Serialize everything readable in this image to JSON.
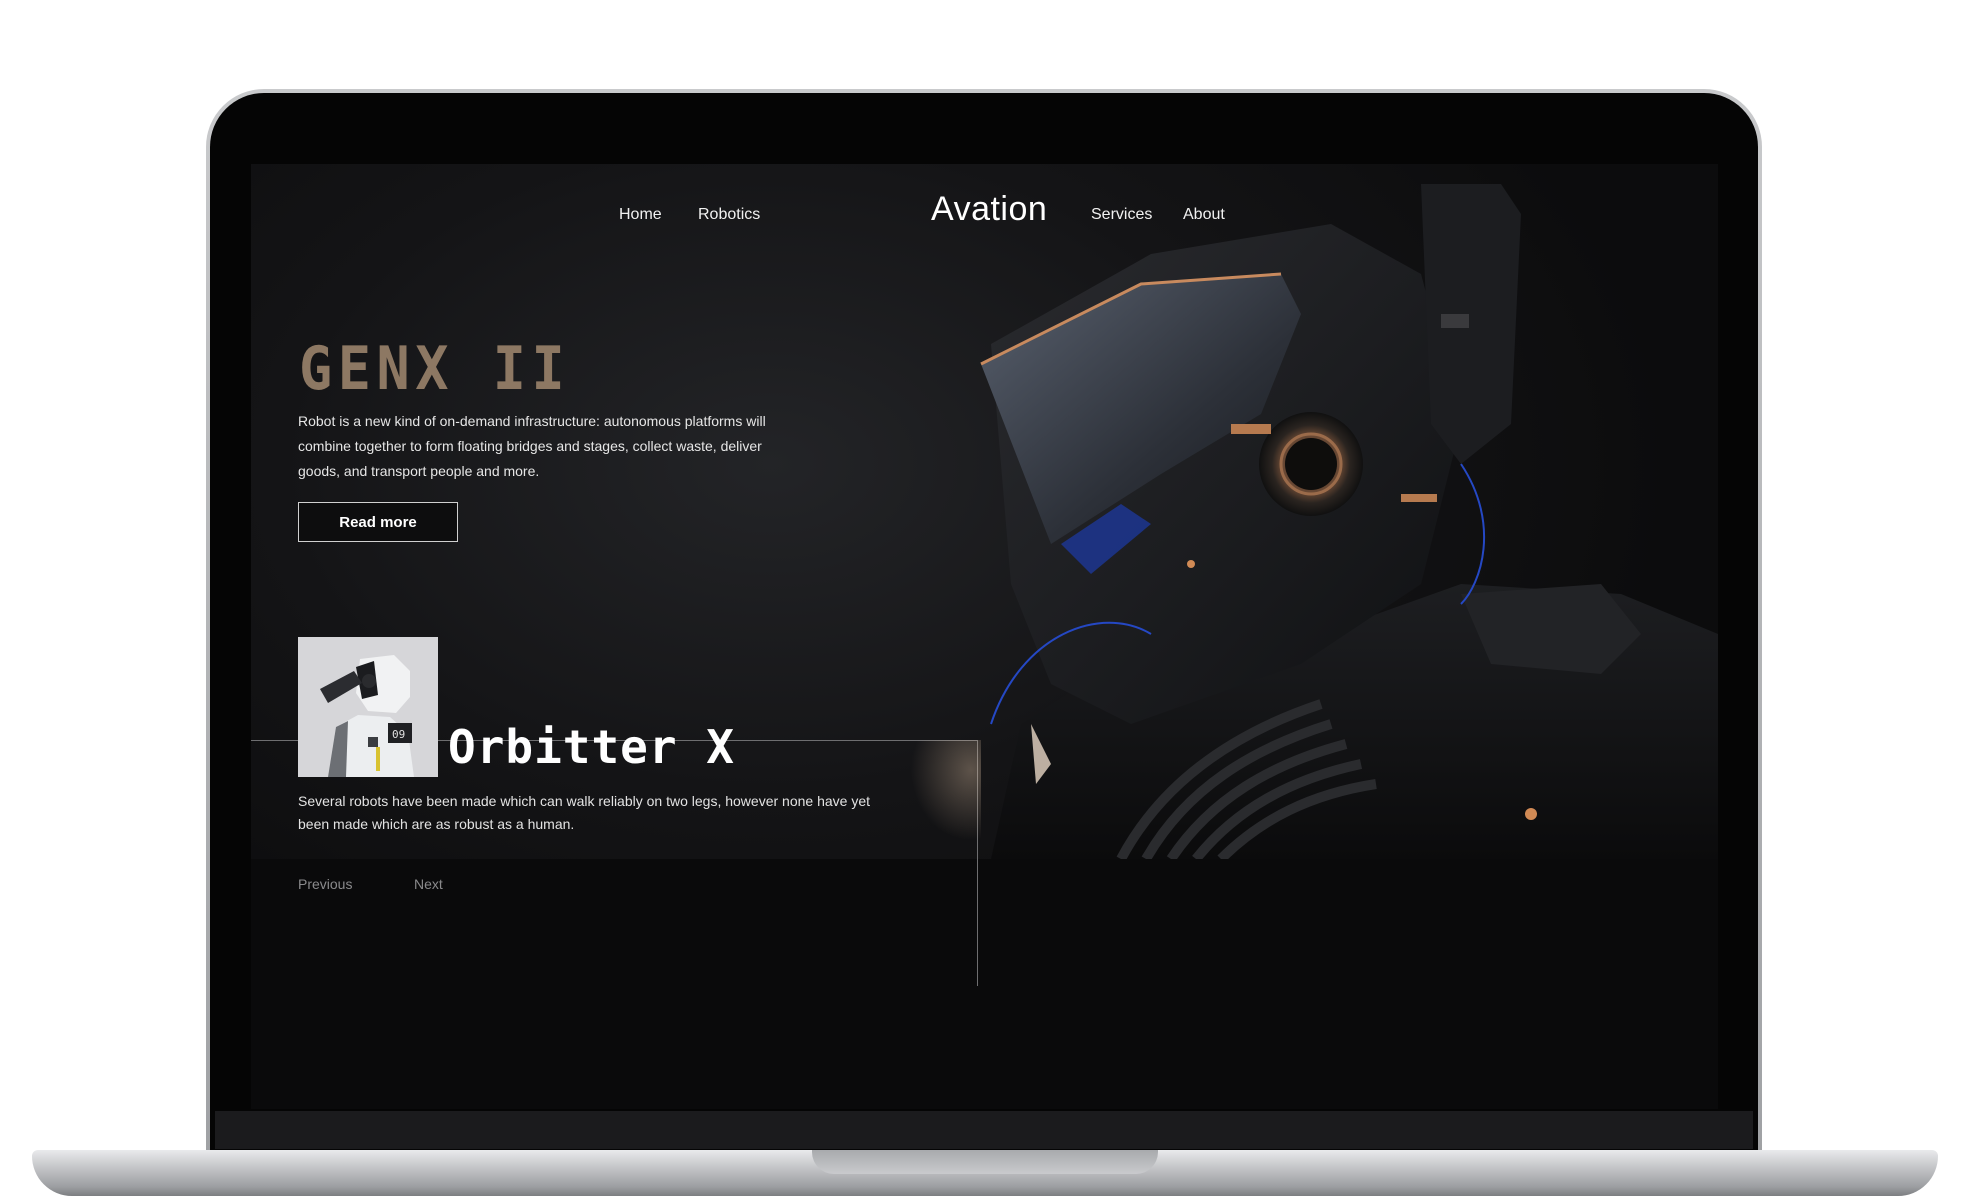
{
  "nav": {
    "home": "Home",
    "robotics": "Robotics",
    "brand": "Avation",
    "services": "Services",
    "about": "About"
  },
  "hero": {
    "title": "GENX II",
    "description": "Robot is a new kind of on-demand infrastructure: autonomous platforms will combine together to form floating bridges and stages, collect waste, deliver goods, and transport people and more.",
    "cta_label": "Read more"
  },
  "card": {
    "title": "Orbitter X",
    "badge_number": "09",
    "description": "Several robots have been made which can walk reliably on two legs, however none have yet been made which are as robust as a human."
  },
  "pager": {
    "previous": "Previous",
    "next": "Next"
  },
  "colors": {
    "background": "#0b0b0c",
    "title_accent": "#8d7863",
    "text": "#e6e6e6",
    "muted": "#8a8a8c"
  }
}
